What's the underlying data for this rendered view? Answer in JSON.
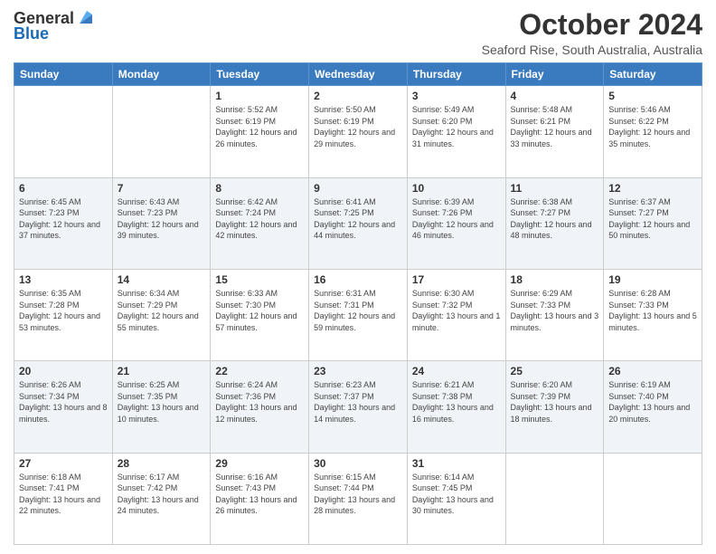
{
  "logo": {
    "line1": "General",
    "line2": "Blue"
  },
  "header": {
    "month": "October 2024",
    "location": "Seaford Rise, South Australia, Australia"
  },
  "weekdays": [
    "Sunday",
    "Monday",
    "Tuesday",
    "Wednesday",
    "Thursday",
    "Friday",
    "Saturday"
  ],
  "weeks": [
    [
      {
        "day": "",
        "sunrise": "",
        "sunset": "",
        "daylight": ""
      },
      {
        "day": "",
        "sunrise": "",
        "sunset": "",
        "daylight": ""
      },
      {
        "day": "1",
        "sunrise": "Sunrise: 5:52 AM",
        "sunset": "Sunset: 6:19 PM",
        "daylight": "Daylight: 12 hours and 26 minutes."
      },
      {
        "day": "2",
        "sunrise": "Sunrise: 5:50 AM",
        "sunset": "Sunset: 6:19 PM",
        "daylight": "Daylight: 12 hours and 29 minutes."
      },
      {
        "day": "3",
        "sunrise": "Sunrise: 5:49 AM",
        "sunset": "Sunset: 6:20 PM",
        "daylight": "Daylight: 12 hours and 31 minutes."
      },
      {
        "day": "4",
        "sunrise": "Sunrise: 5:48 AM",
        "sunset": "Sunset: 6:21 PM",
        "daylight": "Daylight: 12 hours and 33 minutes."
      },
      {
        "day": "5",
        "sunrise": "Sunrise: 5:46 AM",
        "sunset": "Sunset: 6:22 PM",
        "daylight": "Daylight: 12 hours and 35 minutes."
      }
    ],
    [
      {
        "day": "6",
        "sunrise": "Sunrise: 6:45 AM",
        "sunset": "Sunset: 7:23 PM",
        "daylight": "Daylight: 12 hours and 37 minutes."
      },
      {
        "day": "7",
        "sunrise": "Sunrise: 6:43 AM",
        "sunset": "Sunset: 7:23 PM",
        "daylight": "Daylight: 12 hours and 39 minutes."
      },
      {
        "day": "8",
        "sunrise": "Sunrise: 6:42 AM",
        "sunset": "Sunset: 7:24 PM",
        "daylight": "Daylight: 12 hours and 42 minutes."
      },
      {
        "day": "9",
        "sunrise": "Sunrise: 6:41 AM",
        "sunset": "Sunset: 7:25 PM",
        "daylight": "Daylight: 12 hours and 44 minutes."
      },
      {
        "day": "10",
        "sunrise": "Sunrise: 6:39 AM",
        "sunset": "Sunset: 7:26 PM",
        "daylight": "Daylight: 12 hours and 46 minutes."
      },
      {
        "day": "11",
        "sunrise": "Sunrise: 6:38 AM",
        "sunset": "Sunset: 7:27 PM",
        "daylight": "Daylight: 12 hours and 48 minutes."
      },
      {
        "day": "12",
        "sunrise": "Sunrise: 6:37 AM",
        "sunset": "Sunset: 7:27 PM",
        "daylight": "Daylight: 12 hours and 50 minutes."
      }
    ],
    [
      {
        "day": "13",
        "sunrise": "Sunrise: 6:35 AM",
        "sunset": "Sunset: 7:28 PM",
        "daylight": "Daylight: 12 hours and 53 minutes."
      },
      {
        "day": "14",
        "sunrise": "Sunrise: 6:34 AM",
        "sunset": "Sunset: 7:29 PM",
        "daylight": "Daylight: 12 hours and 55 minutes."
      },
      {
        "day": "15",
        "sunrise": "Sunrise: 6:33 AM",
        "sunset": "Sunset: 7:30 PM",
        "daylight": "Daylight: 12 hours and 57 minutes."
      },
      {
        "day": "16",
        "sunrise": "Sunrise: 6:31 AM",
        "sunset": "Sunset: 7:31 PM",
        "daylight": "Daylight: 12 hours and 59 minutes."
      },
      {
        "day": "17",
        "sunrise": "Sunrise: 6:30 AM",
        "sunset": "Sunset: 7:32 PM",
        "daylight": "Daylight: 13 hours and 1 minute."
      },
      {
        "day": "18",
        "sunrise": "Sunrise: 6:29 AM",
        "sunset": "Sunset: 7:33 PM",
        "daylight": "Daylight: 13 hours and 3 minutes."
      },
      {
        "day": "19",
        "sunrise": "Sunrise: 6:28 AM",
        "sunset": "Sunset: 7:33 PM",
        "daylight": "Daylight: 13 hours and 5 minutes."
      }
    ],
    [
      {
        "day": "20",
        "sunrise": "Sunrise: 6:26 AM",
        "sunset": "Sunset: 7:34 PM",
        "daylight": "Daylight: 13 hours and 8 minutes."
      },
      {
        "day": "21",
        "sunrise": "Sunrise: 6:25 AM",
        "sunset": "Sunset: 7:35 PM",
        "daylight": "Daylight: 13 hours and 10 minutes."
      },
      {
        "day": "22",
        "sunrise": "Sunrise: 6:24 AM",
        "sunset": "Sunset: 7:36 PM",
        "daylight": "Daylight: 13 hours and 12 minutes."
      },
      {
        "day": "23",
        "sunrise": "Sunrise: 6:23 AM",
        "sunset": "Sunset: 7:37 PM",
        "daylight": "Daylight: 13 hours and 14 minutes."
      },
      {
        "day": "24",
        "sunrise": "Sunrise: 6:21 AM",
        "sunset": "Sunset: 7:38 PM",
        "daylight": "Daylight: 13 hours and 16 minutes."
      },
      {
        "day": "25",
        "sunrise": "Sunrise: 6:20 AM",
        "sunset": "Sunset: 7:39 PM",
        "daylight": "Daylight: 13 hours and 18 minutes."
      },
      {
        "day": "26",
        "sunrise": "Sunrise: 6:19 AM",
        "sunset": "Sunset: 7:40 PM",
        "daylight": "Daylight: 13 hours and 20 minutes."
      }
    ],
    [
      {
        "day": "27",
        "sunrise": "Sunrise: 6:18 AM",
        "sunset": "Sunset: 7:41 PM",
        "daylight": "Daylight: 13 hours and 22 minutes."
      },
      {
        "day": "28",
        "sunrise": "Sunrise: 6:17 AM",
        "sunset": "Sunset: 7:42 PM",
        "daylight": "Daylight: 13 hours and 24 minutes."
      },
      {
        "day": "29",
        "sunrise": "Sunrise: 6:16 AM",
        "sunset": "Sunset: 7:43 PM",
        "daylight": "Daylight: 13 hours and 26 minutes."
      },
      {
        "day": "30",
        "sunrise": "Sunrise: 6:15 AM",
        "sunset": "Sunset: 7:44 PM",
        "daylight": "Daylight: 13 hours and 28 minutes."
      },
      {
        "day": "31",
        "sunrise": "Sunrise: 6:14 AM",
        "sunset": "Sunset: 7:45 PM",
        "daylight": "Daylight: 13 hours and 30 minutes."
      },
      {
        "day": "",
        "sunrise": "",
        "sunset": "",
        "daylight": ""
      },
      {
        "day": "",
        "sunrise": "",
        "sunset": "",
        "daylight": ""
      }
    ]
  ]
}
